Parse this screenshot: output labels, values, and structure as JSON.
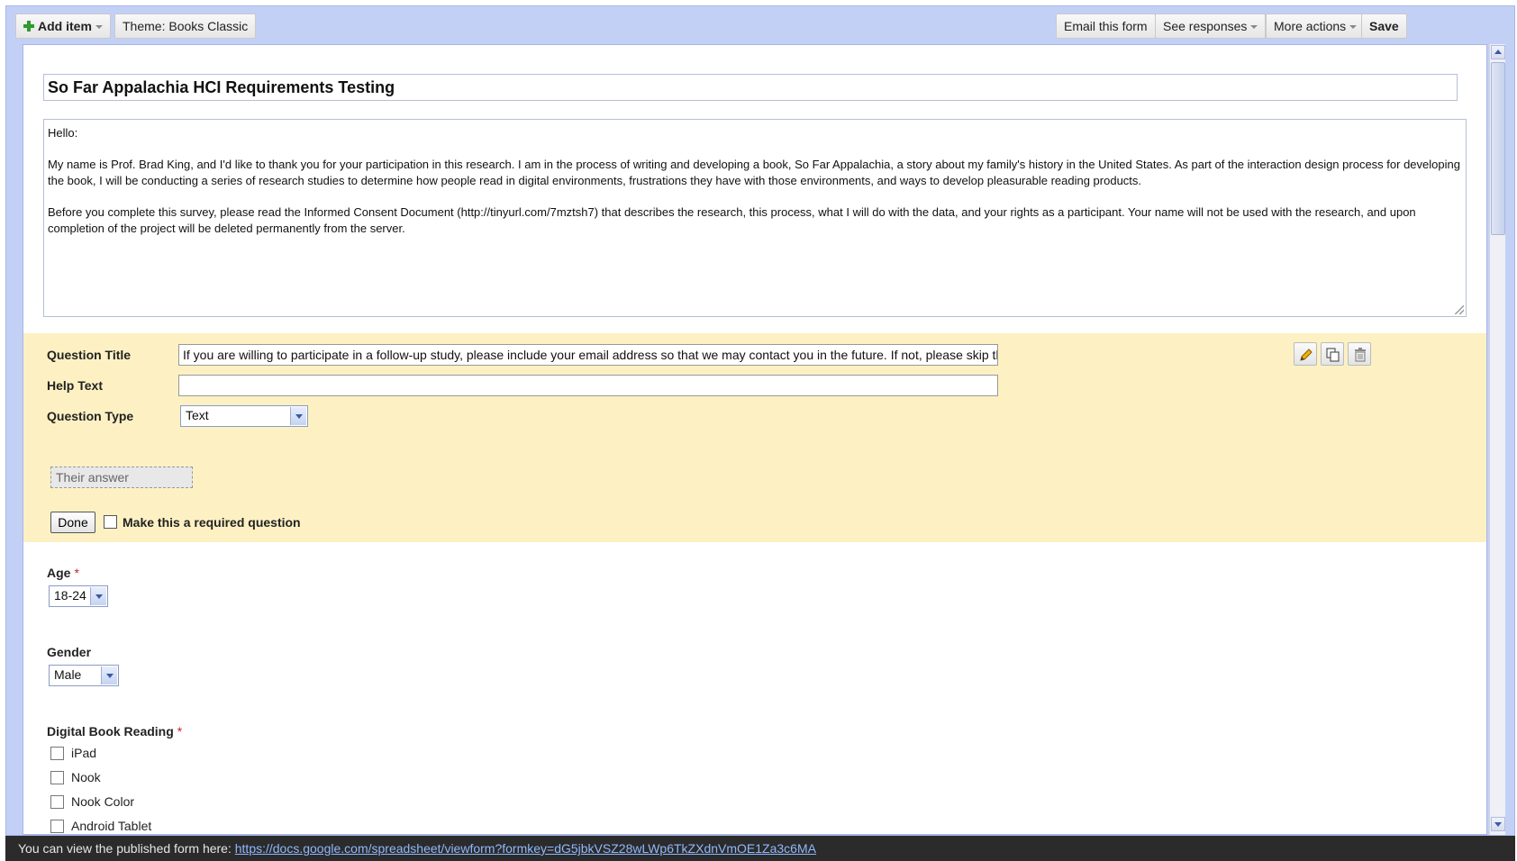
{
  "toolbar": {
    "add_item": "Add item",
    "theme": "Theme:  Books Classic",
    "email_form": "Email this form",
    "see_responses": "See responses",
    "more_actions": "More actions",
    "save": "Save"
  },
  "form": {
    "title": "So Far Appalachia HCI Requirements Testing",
    "description": {
      "greeting": "Hello:",
      "para1": "My name is Prof. Brad King, and I'd like to thank you for your participation in this research. I am in the process of writing and developing a book, So Far Appalachia, a story about my family's history in the United States. As part of the interaction design process for developing the book, I will be conducting a series of research studies to determine how people read in digital environments, frustrations they have with those environments, and ways to develop pleasurable reading products.",
      "para2": "Before you complete this survey, please read the Informed Consent Document (http://tinyurl.com/7mztsh7) that describes the research, this process, what I will do with the data, and your rights as a participant. Your name will not be used with the research, and upon completion of the project will be deleted permanently from the server."
    }
  },
  "edit_question": {
    "question_title_label": "Question Title",
    "question_title_value": "If you are willing to participate in a follow-up study, please include your email address so that we may contact you in the future. If not, please skip this se",
    "help_text_label": "Help Text",
    "help_text_value": "",
    "question_type_label": "Question Type",
    "question_type_value": "Text",
    "answer_preview": "Their answer",
    "done": "Done",
    "required_label": "Make this a required question"
  },
  "questions": {
    "age": {
      "label": "Age",
      "required": "*",
      "value": "18-24"
    },
    "gender": {
      "label": "Gender",
      "value": "Male"
    },
    "digital_reading": {
      "label": "Digital Book Reading",
      "required": "*",
      "options": [
        "iPad",
        "Nook",
        "Nook Color",
        "Android Tablet"
      ]
    }
  },
  "footer": {
    "text": "You can view the published form here: ",
    "link": "https://docs.google.com/spreadsheet/viewform?formkey=dG5jbkVSZ28wLWp6TkZXdnVmOE1Za3c6MA"
  },
  "colors": {
    "toolbar_bg": "#c3d0f6",
    "edit_bg": "#fdf1c3",
    "footer_bg": "#2b2b2b",
    "link": "#8fb8ff"
  },
  "icons": [
    "plus-icon",
    "pencil-icon",
    "duplicate-icon",
    "trash-icon"
  ]
}
